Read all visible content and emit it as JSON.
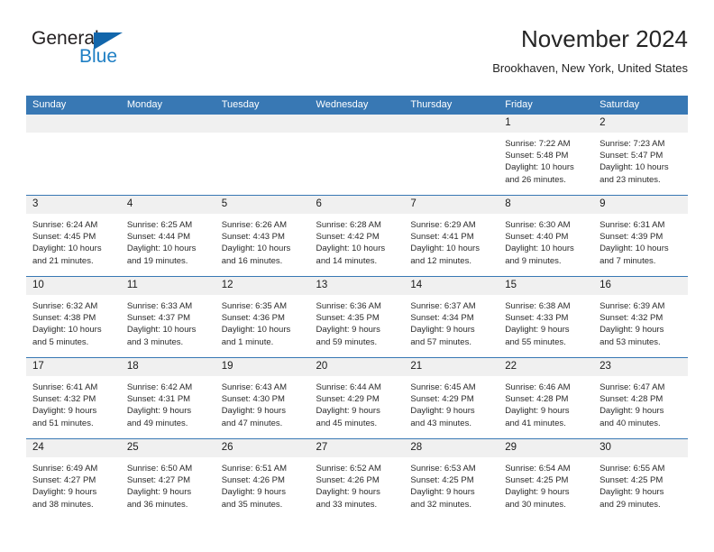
{
  "brand": {
    "word_one": "General",
    "word_two": "Blue",
    "triangle_color": "#1266ab",
    "blue_text_color": "#1f7fc4"
  },
  "header": {
    "title": "November 2024",
    "subtitle": "Brookhaven, New York, United States",
    "header_bg": "#3878b4",
    "daynum_bg": "#f0f0f0"
  },
  "weekday_headers": [
    "Sunday",
    "Monday",
    "Tuesday",
    "Wednesday",
    "Thursday",
    "Friday",
    "Saturday"
  ],
  "labels": {
    "sunrise": "Sunrise:",
    "sunset": "Sunset:",
    "daylight": "Daylight:"
  },
  "weeks": [
    [
      {
        "day": "",
        "sunrise": "",
        "sunset": "",
        "daylight_l1": "",
        "daylight_l2": "",
        "empty": true
      },
      {
        "day": "",
        "sunrise": "",
        "sunset": "",
        "daylight_l1": "",
        "daylight_l2": "",
        "empty": true
      },
      {
        "day": "",
        "sunrise": "",
        "sunset": "",
        "daylight_l1": "",
        "daylight_l2": "",
        "empty": true
      },
      {
        "day": "",
        "sunrise": "",
        "sunset": "",
        "daylight_l1": "",
        "daylight_l2": "",
        "empty": true
      },
      {
        "day": "",
        "sunrise": "",
        "sunset": "",
        "daylight_l1": "",
        "daylight_l2": "",
        "empty": true
      },
      {
        "day": "1",
        "sunrise": "Sunrise: 7:22 AM",
        "sunset": "Sunset: 5:48 PM",
        "daylight_l1": "Daylight: 10 hours",
        "daylight_l2": "and 26 minutes.",
        "empty": false
      },
      {
        "day": "2",
        "sunrise": "Sunrise: 7:23 AM",
        "sunset": "Sunset: 5:47 PM",
        "daylight_l1": "Daylight: 10 hours",
        "daylight_l2": "and 23 minutes.",
        "empty": false
      }
    ],
    [
      {
        "day": "3",
        "sunrise": "Sunrise: 6:24 AM",
        "sunset": "Sunset: 4:45 PM",
        "daylight_l1": "Daylight: 10 hours",
        "daylight_l2": "and 21 minutes.",
        "empty": false
      },
      {
        "day": "4",
        "sunrise": "Sunrise: 6:25 AM",
        "sunset": "Sunset: 4:44 PM",
        "daylight_l1": "Daylight: 10 hours",
        "daylight_l2": "and 19 minutes.",
        "empty": false
      },
      {
        "day": "5",
        "sunrise": "Sunrise: 6:26 AM",
        "sunset": "Sunset: 4:43 PM",
        "daylight_l1": "Daylight: 10 hours",
        "daylight_l2": "and 16 minutes.",
        "empty": false
      },
      {
        "day": "6",
        "sunrise": "Sunrise: 6:28 AM",
        "sunset": "Sunset: 4:42 PM",
        "daylight_l1": "Daylight: 10 hours",
        "daylight_l2": "and 14 minutes.",
        "empty": false
      },
      {
        "day": "7",
        "sunrise": "Sunrise: 6:29 AM",
        "sunset": "Sunset: 4:41 PM",
        "daylight_l1": "Daylight: 10 hours",
        "daylight_l2": "and 12 minutes.",
        "empty": false
      },
      {
        "day": "8",
        "sunrise": "Sunrise: 6:30 AM",
        "sunset": "Sunset: 4:40 PM",
        "daylight_l1": "Daylight: 10 hours",
        "daylight_l2": "and 9 minutes.",
        "empty": false
      },
      {
        "day": "9",
        "sunrise": "Sunrise: 6:31 AM",
        "sunset": "Sunset: 4:39 PM",
        "daylight_l1": "Daylight: 10 hours",
        "daylight_l2": "and 7 minutes.",
        "empty": false
      }
    ],
    [
      {
        "day": "10",
        "sunrise": "Sunrise: 6:32 AM",
        "sunset": "Sunset: 4:38 PM",
        "daylight_l1": "Daylight: 10 hours",
        "daylight_l2": "and 5 minutes.",
        "empty": false
      },
      {
        "day": "11",
        "sunrise": "Sunrise: 6:33 AM",
        "sunset": "Sunset: 4:37 PM",
        "daylight_l1": "Daylight: 10 hours",
        "daylight_l2": "and 3 minutes.",
        "empty": false
      },
      {
        "day": "12",
        "sunrise": "Sunrise: 6:35 AM",
        "sunset": "Sunset: 4:36 PM",
        "daylight_l1": "Daylight: 10 hours",
        "daylight_l2": "and 1 minute.",
        "empty": false
      },
      {
        "day": "13",
        "sunrise": "Sunrise: 6:36 AM",
        "sunset": "Sunset: 4:35 PM",
        "daylight_l1": "Daylight: 9 hours",
        "daylight_l2": "and 59 minutes.",
        "empty": false
      },
      {
        "day": "14",
        "sunrise": "Sunrise: 6:37 AM",
        "sunset": "Sunset: 4:34 PM",
        "daylight_l1": "Daylight: 9 hours",
        "daylight_l2": "and 57 minutes.",
        "empty": false
      },
      {
        "day": "15",
        "sunrise": "Sunrise: 6:38 AM",
        "sunset": "Sunset: 4:33 PM",
        "daylight_l1": "Daylight: 9 hours",
        "daylight_l2": "and 55 minutes.",
        "empty": false
      },
      {
        "day": "16",
        "sunrise": "Sunrise: 6:39 AM",
        "sunset": "Sunset: 4:32 PM",
        "daylight_l1": "Daylight: 9 hours",
        "daylight_l2": "and 53 minutes.",
        "empty": false
      }
    ],
    [
      {
        "day": "17",
        "sunrise": "Sunrise: 6:41 AM",
        "sunset": "Sunset: 4:32 PM",
        "daylight_l1": "Daylight: 9 hours",
        "daylight_l2": "and 51 minutes.",
        "empty": false
      },
      {
        "day": "18",
        "sunrise": "Sunrise: 6:42 AM",
        "sunset": "Sunset: 4:31 PM",
        "daylight_l1": "Daylight: 9 hours",
        "daylight_l2": "and 49 minutes.",
        "empty": false
      },
      {
        "day": "19",
        "sunrise": "Sunrise: 6:43 AM",
        "sunset": "Sunset: 4:30 PM",
        "daylight_l1": "Daylight: 9 hours",
        "daylight_l2": "and 47 minutes.",
        "empty": false
      },
      {
        "day": "20",
        "sunrise": "Sunrise: 6:44 AM",
        "sunset": "Sunset: 4:29 PM",
        "daylight_l1": "Daylight: 9 hours",
        "daylight_l2": "and 45 minutes.",
        "empty": false
      },
      {
        "day": "21",
        "sunrise": "Sunrise: 6:45 AM",
        "sunset": "Sunset: 4:29 PM",
        "daylight_l1": "Daylight: 9 hours",
        "daylight_l2": "and 43 minutes.",
        "empty": false
      },
      {
        "day": "22",
        "sunrise": "Sunrise: 6:46 AM",
        "sunset": "Sunset: 4:28 PM",
        "daylight_l1": "Daylight: 9 hours",
        "daylight_l2": "and 41 minutes.",
        "empty": false
      },
      {
        "day": "23",
        "sunrise": "Sunrise: 6:47 AM",
        "sunset": "Sunset: 4:28 PM",
        "daylight_l1": "Daylight: 9 hours",
        "daylight_l2": "and 40 minutes.",
        "empty": false
      }
    ],
    [
      {
        "day": "24",
        "sunrise": "Sunrise: 6:49 AM",
        "sunset": "Sunset: 4:27 PM",
        "daylight_l1": "Daylight: 9 hours",
        "daylight_l2": "and 38 minutes.",
        "empty": false
      },
      {
        "day": "25",
        "sunrise": "Sunrise: 6:50 AM",
        "sunset": "Sunset: 4:27 PM",
        "daylight_l1": "Daylight: 9 hours",
        "daylight_l2": "and 36 minutes.",
        "empty": false
      },
      {
        "day": "26",
        "sunrise": "Sunrise: 6:51 AM",
        "sunset": "Sunset: 4:26 PM",
        "daylight_l1": "Daylight: 9 hours",
        "daylight_l2": "and 35 minutes.",
        "empty": false
      },
      {
        "day": "27",
        "sunrise": "Sunrise: 6:52 AM",
        "sunset": "Sunset: 4:26 PM",
        "daylight_l1": "Daylight: 9 hours",
        "daylight_l2": "and 33 minutes.",
        "empty": false
      },
      {
        "day": "28",
        "sunrise": "Sunrise: 6:53 AM",
        "sunset": "Sunset: 4:25 PM",
        "daylight_l1": "Daylight: 9 hours",
        "daylight_l2": "and 32 minutes.",
        "empty": false
      },
      {
        "day": "29",
        "sunrise": "Sunrise: 6:54 AM",
        "sunset": "Sunset: 4:25 PM",
        "daylight_l1": "Daylight: 9 hours",
        "daylight_l2": "and 30 minutes.",
        "empty": false
      },
      {
        "day": "30",
        "sunrise": "Sunrise: 6:55 AM",
        "sunset": "Sunset: 4:25 PM",
        "daylight_l1": "Daylight: 9 hours",
        "daylight_l2": "and 29 minutes.",
        "empty": false
      }
    ]
  ]
}
